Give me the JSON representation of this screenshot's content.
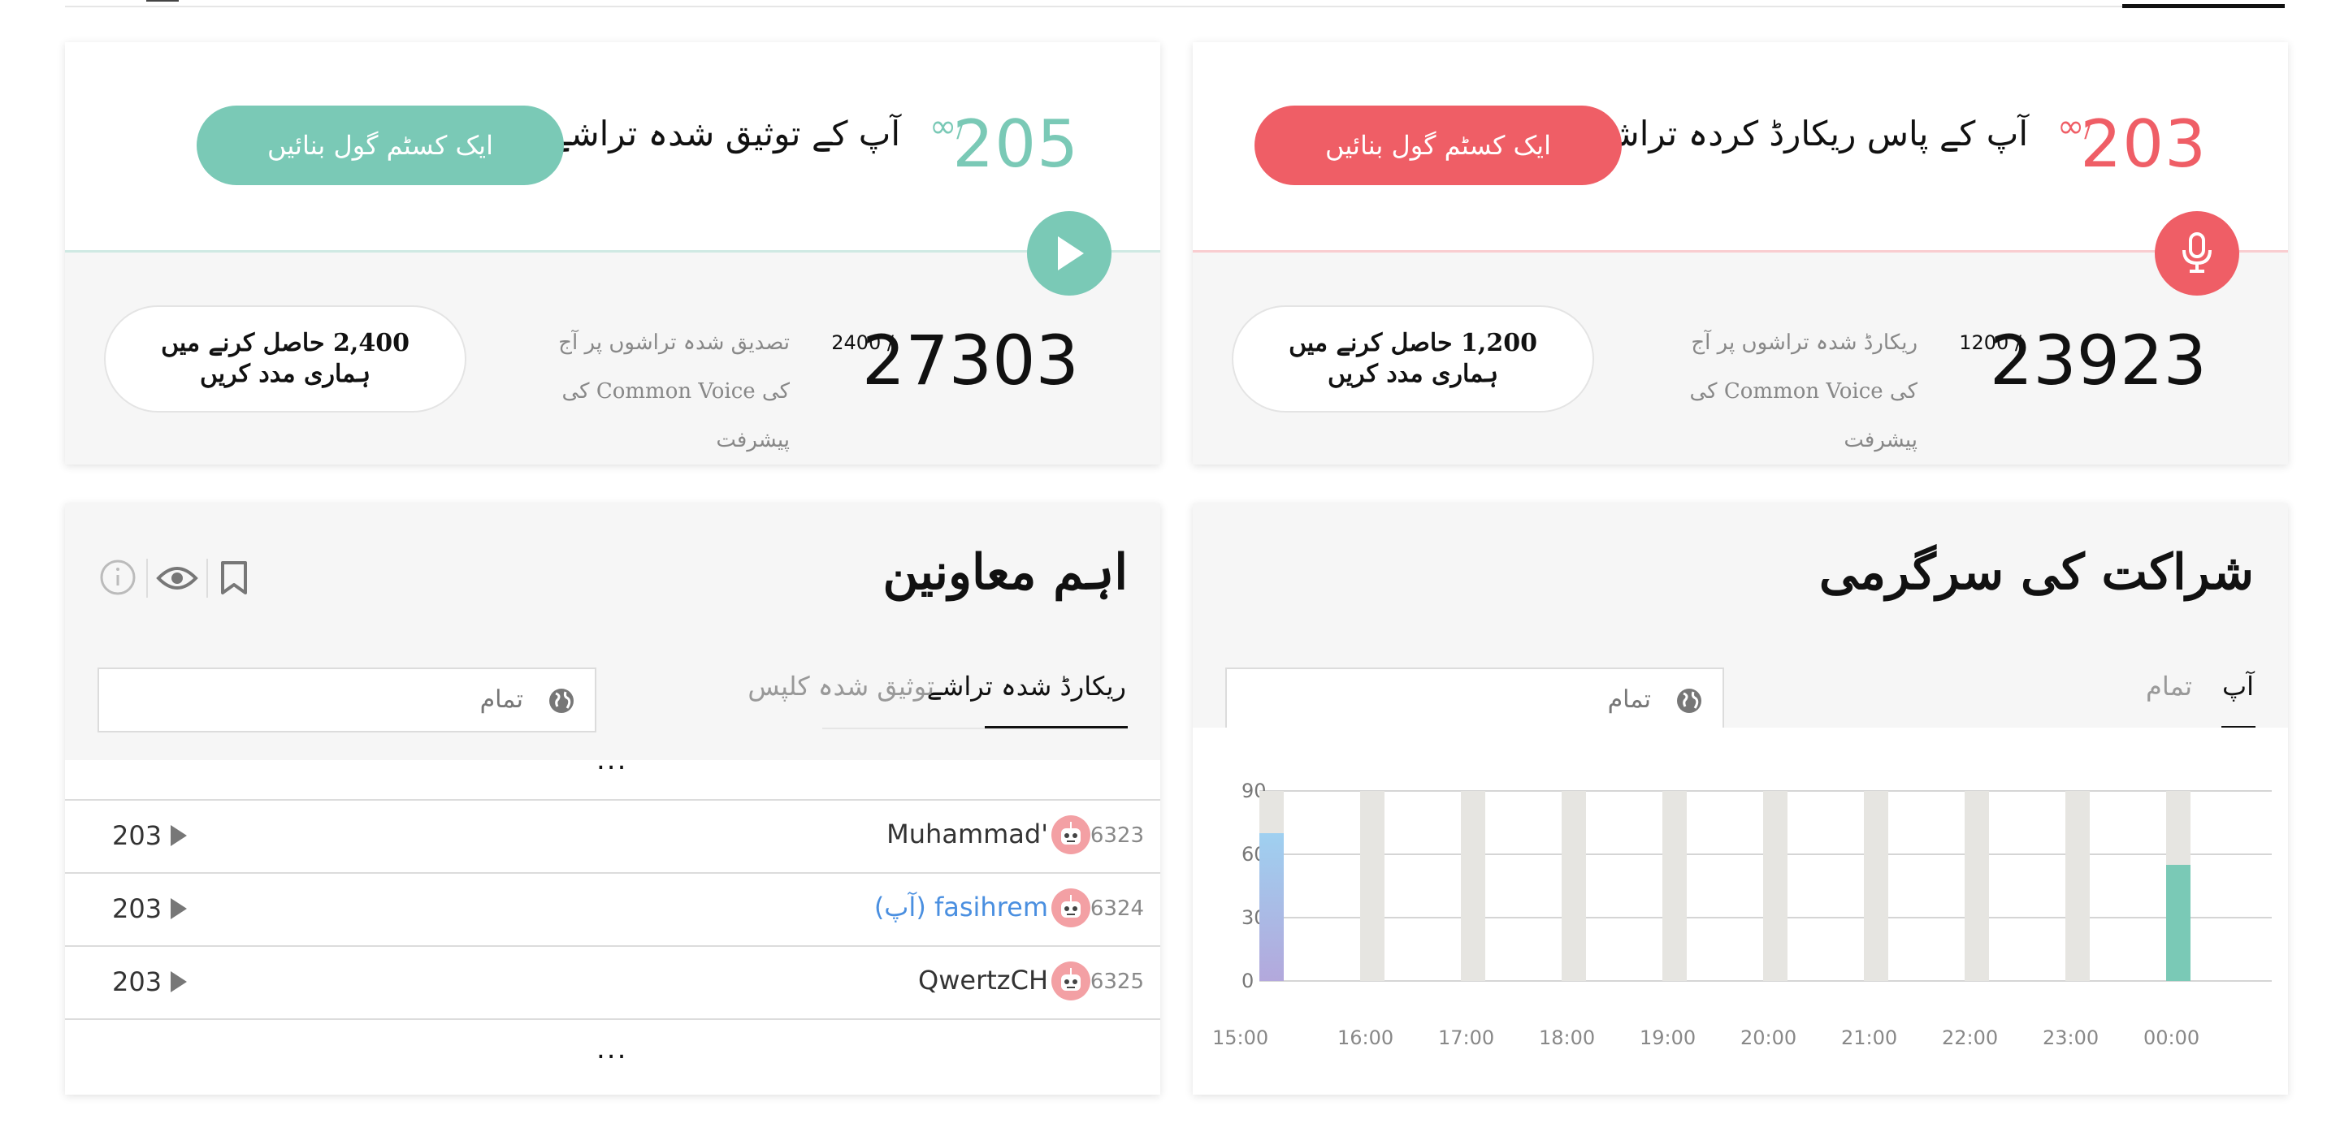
{
  "recorded_card": {
    "count": "203",
    "goal_symbol": "∞",
    "title": "آپ کے پاس ریکارڈ کردہ تراشے",
    "goal_button": "ایک کسٹم گول بنائیں",
    "total": "23923",
    "daily_goal": "1200",
    "progress_text": "ریکارڈ شدہ تراشوں پر آج کی Common Voice کی پیشرفت",
    "help_line1": "1,200 حاصل کرنے میں",
    "help_line2": "ہماری مدد کریں",
    "accent": "#ef5e66"
  },
  "validated_card": {
    "count": "205",
    "goal_symbol": "∞",
    "title": "آپ کے توثیق شدہ تراشے",
    "goal_button": "ایک کسٹم گول بنائیں",
    "total": "27303",
    "daily_goal": "2400",
    "progress_text": "تصدیق شدہ تراشوں پر آج کی Common Voice کی پیشرفت",
    "help_line1": "2,400 حاصل کرنے میں",
    "help_line2": "ہماری مدد کریں",
    "accent": "#7ac9b6"
  },
  "activity": {
    "title": "شراکت کی سرگرمی",
    "tabs": [
      "آپ",
      "تمام"
    ],
    "active_tab": "آپ",
    "language_select": "تمام"
  },
  "contributors": {
    "title": "اہم معاونین",
    "tabs": [
      "ریکارڈ شدہ تراشے",
      "توثیق شدہ کلپس"
    ],
    "active_tab": "ریکارڈ شدہ تراشے",
    "language_select": "تمام",
    "ellipsis": "...",
    "rows": [
      {
        "rank": "6323",
        "name": "Muhammad'",
        "count": "203",
        "is_you": false
      },
      {
        "rank": "6324",
        "name": "fasihrem (آپ)",
        "count": "203",
        "is_you": true
      },
      {
        "rank": "6325",
        "name": "QwertzCH",
        "count": "203",
        "is_you": false
      }
    ],
    "icons": [
      "info-icon",
      "eye-icon",
      "bookmark-icon"
    ]
  },
  "chart_data": {
    "type": "bar",
    "categories": [
      "15:00",
      "16:00",
      "17:00",
      "18:00",
      "19:00",
      "20:00",
      "21:00",
      "22:00",
      "23:00",
      "00:00"
    ],
    "series": [
      {
        "values": [
          70,
          0,
          0,
          0,
          0,
          0,
          0,
          0,
          0,
          55
        ]
      }
    ],
    "background_bar_value": 90,
    "ylim": [
      0,
      90
    ],
    "yticks": [
      "0",
      "30",
      "60",
      "90"
    ],
    "grid": true,
    "colors": [
      "#9fd0f0",
      "#7ac9b6",
      "#e6e5e1"
    ]
  }
}
